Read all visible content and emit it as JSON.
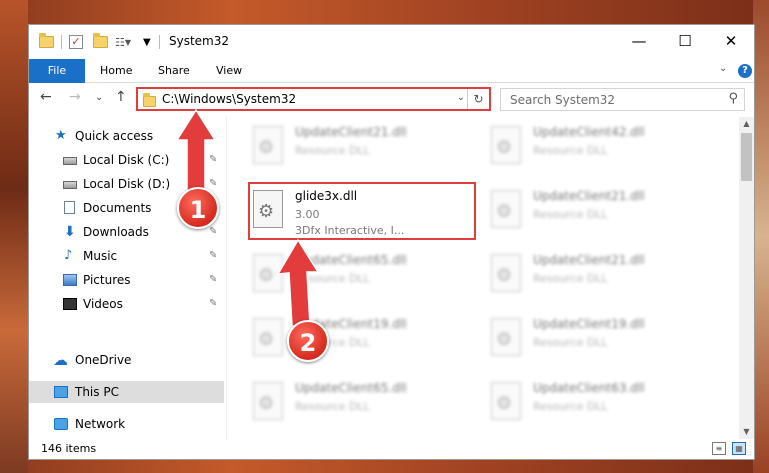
{
  "window": {
    "title": "System32",
    "min_symbol": "—",
    "max_symbol": "☐",
    "close_symbol": "✕"
  },
  "ribbon": {
    "file_tab": "File",
    "tabs": [
      "Home",
      "Share",
      "View"
    ],
    "help": "?",
    "collapse": "⌄"
  },
  "nav": {
    "back": "←",
    "forward": "→",
    "recent": "⌄",
    "up": "↑",
    "address": "C:\\Windows\\System32",
    "address_dropdown": "⌄",
    "refresh": "↻",
    "search_placeholder": "Search System32",
    "search_icon": "⚲"
  },
  "navpane": {
    "items": [
      {
        "label": "Quick access",
        "icon": "star-icon",
        "pinned": false
      },
      {
        "label": "Local Disk (C:)",
        "icon": "drive-icon",
        "pinned": true
      },
      {
        "label": "Local Disk (D:)",
        "icon": "drive-icon",
        "pinned": true
      },
      {
        "label": "Documents",
        "icon": "documents-icon",
        "pinned": true
      },
      {
        "label": "Downloads",
        "icon": "downloads-icon",
        "pinned": true
      },
      {
        "label": "Music",
        "icon": "music-icon",
        "pinned": true
      },
      {
        "label": "Pictures",
        "icon": "pictures-icon",
        "pinned": true
      },
      {
        "label": "Videos",
        "icon": "videos-icon",
        "pinned": true
      },
      {
        "label": "OneDrive",
        "icon": "onedrive-icon",
        "pinned": false
      },
      {
        "label": "This PC",
        "icon": "this-pc-icon",
        "pinned": false,
        "selected": true
      },
      {
        "label": "Network",
        "icon": "network-icon",
        "pinned": false
      }
    ],
    "pin_symbol": "📌"
  },
  "files": {
    "highlighted": {
      "name": "glide3x.dll",
      "version": "3.00",
      "company": "3Dfx Interactive, I..."
    },
    "blurred": [
      {
        "name": "UpdateClient21.dll",
        "type": "Resource DLL"
      },
      {
        "name": "UpdateClient42.dll",
        "type": "Resource DLL"
      },
      {
        "name": "UpdateClient21.dll",
        "type": "Resource DLL"
      },
      {
        "name": "UpdateClient65.dll",
        "type": "Resource DLL"
      },
      {
        "name": "UpdateClient21.dll",
        "type": "Resource DLL"
      },
      {
        "name": "UpdateClient19.dll",
        "type": "Resource DLL"
      },
      {
        "name": "UpdateClient19.dll",
        "type": "Resource DLL"
      },
      {
        "name": "UpdateClient65.dll",
        "type": "Resource DLL"
      },
      {
        "name": "UpdateClient63.dll",
        "type": "Resource DLL"
      }
    ]
  },
  "status": {
    "count": "146 items"
  },
  "annotations": {
    "step1": "1",
    "step2": "2"
  },
  "colors": {
    "accent": "#1a6fc6",
    "highlight": "#e23c3c"
  }
}
